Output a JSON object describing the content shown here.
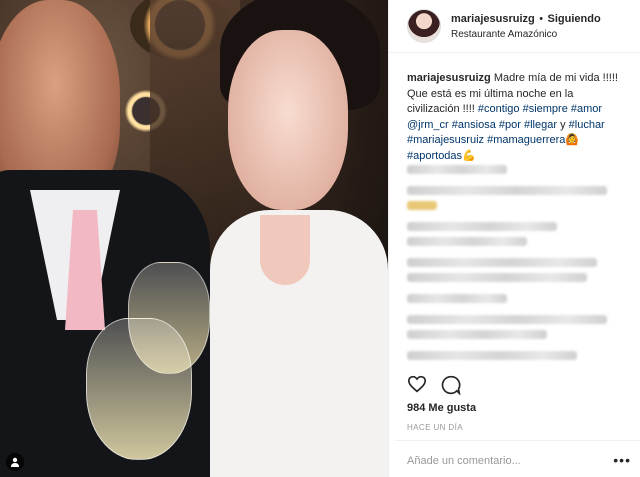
{
  "header": {
    "username": "mariajesusruizg",
    "separator": "•",
    "follow_status": "Siguiendo",
    "location": "Restaurante Amazónico"
  },
  "caption": {
    "username": "mariajesusruizg",
    "text_1": "Madre mía de mi vida !!!!! Que está es mi última noche en la civilización !!!! ",
    "tag_contigo": "#contigo",
    "tag_siempre": "#siempre",
    "tag_amor": "#amor",
    "mention": "@jrm_cr",
    "tag_ansiosa": "#ansiosa",
    "tag_por": "#por",
    "tag_llegar": "#llegar",
    "word_y": " y ",
    "tag_luchar": "#luchar",
    "tag_mariajesusruiz": "#mariajesusruiz",
    "tag_mamaguerrera": "#mamaguerrera",
    "tag_aportodas": "#aportodas",
    "emoji_1": "🙆",
    "emoji_2": "💪"
  },
  "likes": "984 Me gusta",
  "timestamp": "HACE UN DÍA",
  "comment_placeholder": "Añade un comentario...",
  "more_label": "•••",
  "icons": [
    "heart-icon",
    "comment-icon",
    "user-tag-icon"
  ],
  "colors": {
    "hashtag": "#003569",
    "muted": "#999999",
    "text": "#262626"
  }
}
